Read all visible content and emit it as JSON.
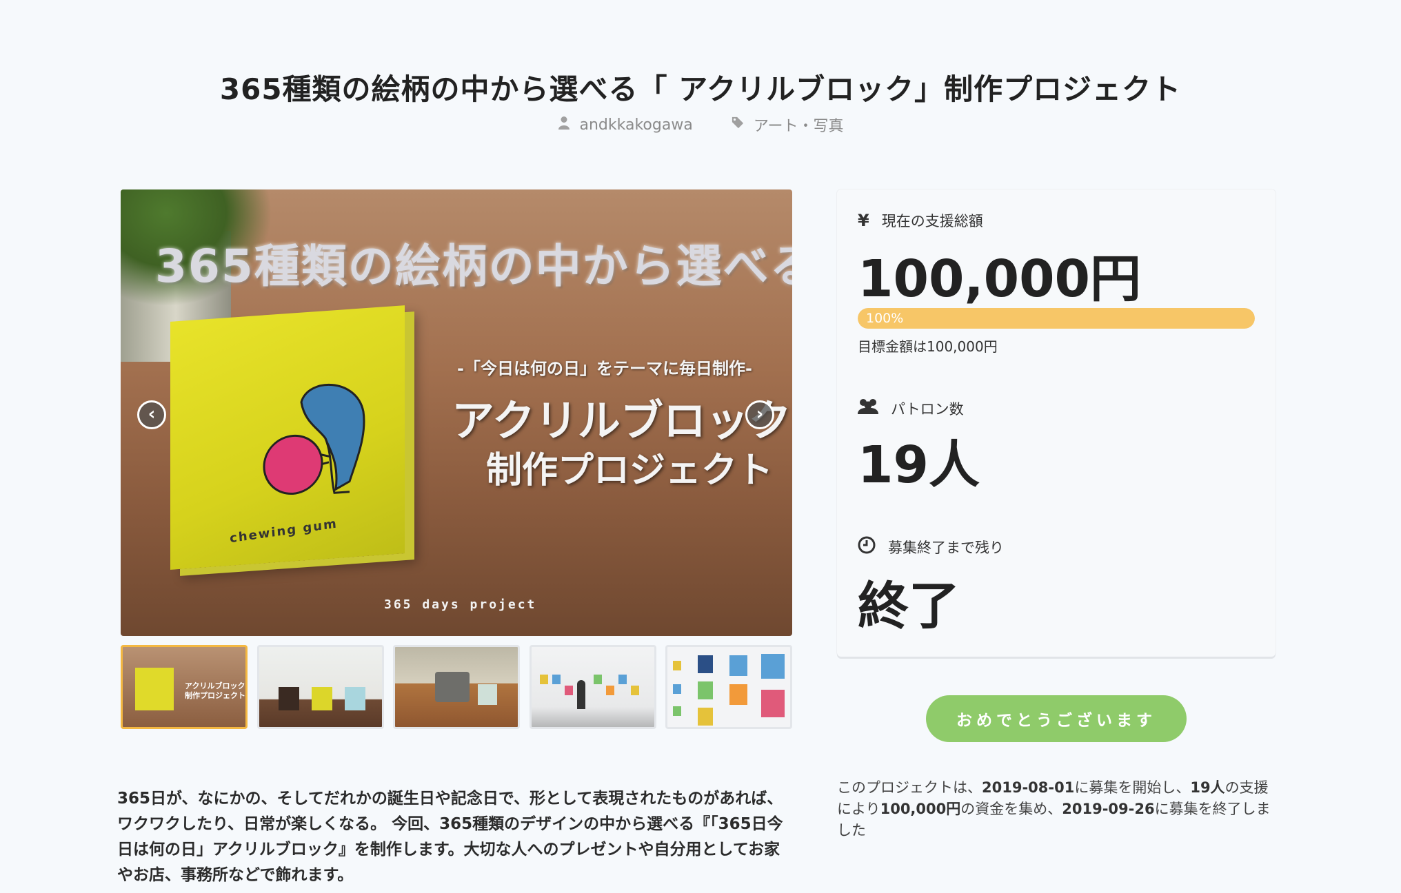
{
  "project": {
    "title": "365種類の絵柄の中から選べる「 アクリルブロック」制作プロジェクト",
    "author": "andkkakogawa",
    "category": "アート・写真",
    "icons": {
      "author": "user-icon",
      "category": "tag-icon"
    }
  },
  "hero": {
    "headline": "365種類の絵柄の中から選べる",
    "subheadline": "-「今日は何の日」をテーマに毎日制作-",
    "big_line1": "アクリルブロック",
    "big_line2": "制作プロジェクト",
    "block_label": "chewing gum",
    "footer": "365 days project",
    "prev": "‹",
    "next": "›"
  },
  "thumbnails": {
    "active_index": 0,
    "t1_text": "アクリルブロック\n制作プロジェクト",
    "t1_headline": "365種類の絵柄の中から選べる"
  },
  "description": "365日が、なにかの、そしてだれかの誕生日や記念日で、形として表現されたものがあれば、ワクワクしたり、日常が楽しくなる。 今回、365種類のデザインの中から選べる『「365日今日は何の日」アクリルブロック』を制作します。大切な人へのプレゼントや自分用としてお家やお店、事務所などで飾れます。",
  "stats": {
    "funding": {
      "label": "現在の支援総額",
      "value": "100,000円",
      "icon": "yen-icon"
    },
    "progress": {
      "percent": 100,
      "label": "100%"
    },
    "goal": "目標金額は100,000円",
    "patrons": {
      "label": "パトロン数",
      "value": "19人",
      "icon": "users-icon"
    },
    "remaining": {
      "label": "募集終了まで残り",
      "value": "終了",
      "icon": "clock-icon"
    }
  },
  "cta_label": "おめでとうございます",
  "summary": {
    "p1": "このプロジェクトは、",
    "start": "2019-08-01",
    "p2": "に募集を開始し、",
    "patrons": "19人",
    "p3": "の支援により",
    "amount": "100,000円",
    "p4": "の資金を集め、",
    "end": "2019-09-26",
    "p5": "に募集を終了しました"
  },
  "colors": {
    "accent_progress": "#f7c667",
    "button": "#8fcb6a",
    "active_thumb": "#f4b842",
    "background": "#f6f9fc"
  }
}
